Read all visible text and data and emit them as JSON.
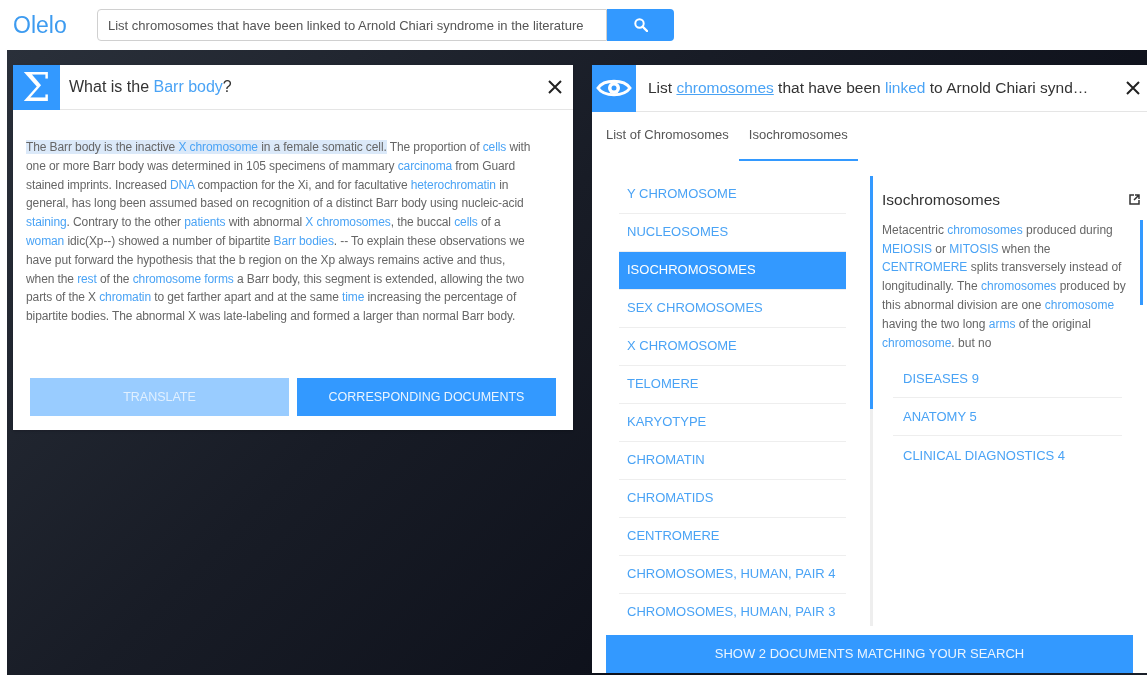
{
  "header": {
    "logo": "Olelo",
    "search": {
      "value": "List chromosomes that have been linked to Arnold Chiari syndrome in the literature"
    }
  },
  "definition_panel": {
    "icon_glyph": "Σ",
    "title": [
      {
        "text": "What is the ",
        "link": false
      },
      {
        "text": "Barr body",
        "link": true
      },
      {
        "text": "?",
        "link": false
      }
    ],
    "paragraph": [
      {
        "text": "The Barr body is the inactive ",
        "link": false,
        "highlighted": true
      },
      {
        "text": "X chromosome",
        "link": true,
        "highlighted": true
      },
      {
        "text": " in a female somatic cell.",
        "link": false,
        "highlighted": true
      },
      {
        "text": " The proportion of ",
        "link": false,
        "highlighted": false
      },
      {
        "text": "cells",
        "link": true,
        "highlighted": false
      },
      {
        "text": " with one or more Barr body was determined in 105 specimens of mammary ",
        "link": false,
        "highlighted": false
      },
      {
        "text": "carcinoma",
        "link": true,
        "highlighted": false
      },
      {
        "text": " from Guard stained imprints. Increased ",
        "link": false,
        "highlighted": false
      },
      {
        "text": "DNA",
        "link": true,
        "highlighted": false
      },
      {
        "text": " compaction for the Xi, and for facultative ",
        "link": false,
        "highlighted": false
      },
      {
        "text": "heterochromatin",
        "link": true,
        "highlighted": false
      },
      {
        "text": " in general, has long been assumed based on recognition of a distinct Barr body using nucleic-acid ",
        "link": false,
        "highlighted": false
      },
      {
        "text": "staining",
        "link": true,
        "highlighted": false
      },
      {
        "text": ". Contrary to the other ",
        "link": false,
        "highlighted": false
      },
      {
        "text": "patients",
        "link": true,
        "highlighted": false
      },
      {
        "text": " with abnormal ",
        "link": false,
        "highlighted": false
      },
      {
        "text": "X chromosomes",
        "link": true,
        "highlighted": false
      },
      {
        "text": ", the buccal ",
        "link": false,
        "highlighted": false
      },
      {
        "text": "cells",
        "link": true,
        "highlighted": false
      },
      {
        "text": " of a ",
        "link": false,
        "highlighted": false
      },
      {
        "text": "woman",
        "link": true,
        "highlighted": false
      },
      {
        "text": " idic(Xp--) showed a number of bipartite ",
        "link": false,
        "highlighted": false
      },
      {
        "text": "Barr bodies",
        "link": true,
        "highlighted": false
      },
      {
        "text": ". -- To explain these observations we have put forward the hypothesis that the b region on the Xp always remains active and thus, when the ",
        "link": false,
        "highlighted": false
      },
      {
        "text": "rest",
        "link": true,
        "highlighted": false
      },
      {
        "text": " of the ",
        "link": false,
        "highlighted": false
      },
      {
        "text": "chromosome forms",
        "link": true,
        "highlighted": false
      },
      {
        "text": " a Barr body, this segment is extended, allowing the two parts of the X ",
        "link": false,
        "highlighted": false
      },
      {
        "text": "chromatin",
        "link": true,
        "highlighted": false
      },
      {
        "text": " to get farther apart and at the same ",
        "link": false,
        "highlighted": false
      },
      {
        "text": "time",
        "link": true,
        "highlighted": false
      },
      {
        "text": " increasing the percentage of bipartite bodies. The abnormal X was late-labeling and formed a larger than normal Barr body.",
        "link": false,
        "highlighted": false
      }
    ],
    "buttons": [
      {
        "label": "TRANSLATE",
        "disabled": true
      },
      {
        "label": "CORRESPONDING DOCUMENTS",
        "disabled": false
      }
    ]
  },
  "results_panel": {
    "title": [
      {
        "text": "List ",
        "link": false,
        "underlined": false
      },
      {
        "text": "chromosomes",
        "link": true,
        "underlined": true
      },
      {
        "text": " that have been ",
        "link": false,
        "underlined": false
      },
      {
        "text": "linked",
        "link": true,
        "underlined": false
      },
      {
        "text": " to Arnold Chiari synd…",
        "link": false,
        "underlined": false
      }
    ],
    "tabs": [
      {
        "label": "List of Chromosomes",
        "selected": false
      },
      {
        "label": "Isochromosomes",
        "selected": true
      }
    ],
    "items": [
      {
        "label": "Y CHROMOSOME",
        "selected": false
      },
      {
        "label": "NUCLEOSOMES",
        "selected": false
      },
      {
        "label": "ISOCHROMOSOMES",
        "selected": true
      },
      {
        "label": "SEX CHROMOSOMES",
        "selected": false
      },
      {
        "label": "X CHROMOSOME",
        "selected": false
      },
      {
        "label": "TELOMERE",
        "selected": false
      },
      {
        "label": "KARYOTYPE",
        "selected": false
      },
      {
        "label": "CHROMATIN",
        "selected": false
      },
      {
        "label": "CHROMATIDS",
        "selected": false
      },
      {
        "label": "CENTROMERE",
        "selected": false
      },
      {
        "label": "CHROMOSOMES, HUMAN, PAIR 4",
        "selected": false
      },
      {
        "label": "CHROMOSOMES, HUMAN, PAIR 3",
        "selected": false
      }
    ],
    "detail": {
      "title": "Isochromosomes",
      "description": [
        {
          "text": "Metacentric ",
          "link": false
        },
        {
          "text": "chromosomes",
          "link": true
        },
        {
          "text": " produced during ",
          "link": false
        },
        {
          "text": "MEIOSIS",
          "link": true
        },
        {
          "text": " or ",
          "link": false
        },
        {
          "text": "MITOSIS",
          "link": true
        },
        {
          "text": " when the ",
          "link": false
        },
        {
          "text": "CENTROMERE",
          "link": true
        },
        {
          "text": " splits transversely instead of longitudinally. The ",
          "link": false
        },
        {
          "text": "chromosomes",
          "link": true
        },
        {
          "text": " produced by this abnormal division are one ",
          "link": false
        },
        {
          "text": "chromosome",
          "link": true
        },
        {
          "text": " having the two long ",
          "link": false
        },
        {
          "text": "arms",
          "link": true
        },
        {
          "text": " of the original ",
          "link": false
        },
        {
          "text": "chromosome",
          "link": true
        },
        {
          "text": ". but no",
          "link": false
        }
      ],
      "categories": [
        "DISEASES 9",
        "ANATOMY 5",
        "CLINICAL DIAGNOSTICS 4"
      ]
    },
    "footer_button": "SHOW 2 DOCUMENTS MATCHING YOUR SEARCH"
  }
}
